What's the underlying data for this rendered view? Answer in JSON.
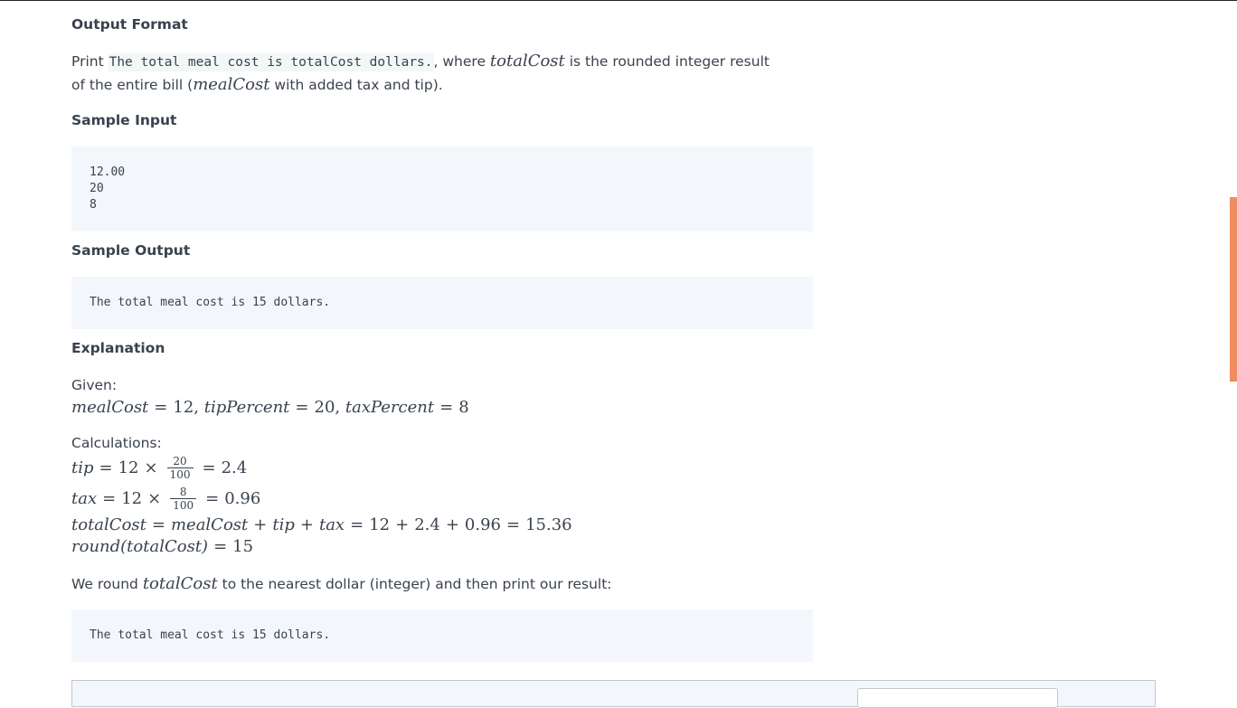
{
  "output_format": {
    "heading": "Output Format",
    "line1_prefix": "Print ",
    "line1_code": "The total meal cost is totalCost dollars.",
    "line1_mid": ", where ",
    "line1_var": "totalCost",
    "line1_suffix": " is the rounded integer result",
    "line2_prefix": "of the entire bill (",
    "line2_var": "mealCost",
    "line2_suffix": " with added tax and tip)."
  },
  "sample_input": {
    "heading": "Sample Input",
    "lines": [
      "12.00",
      "20",
      "8"
    ]
  },
  "sample_output": {
    "heading": "Sample Output",
    "text": "The total meal cost is 15 dollars."
  },
  "explanation": {
    "heading": "Explanation",
    "given_label": "Given:",
    "given": {
      "v1": "mealCost",
      "n1": "12,",
      "v2": "tipPercent",
      "n2": "20,",
      "v3": "taxPercent",
      "n3": "8"
    },
    "calc_label": "Calculations:",
    "tip": {
      "var": "tip",
      "n": "12",
      "num": "20",
      "den": "100",
      "res": "2.4"
    },
    "tax": {
      "var": "tax",
      "n": "12",
      "num": "8",
      "den": "100",
      "res": "0.96"
    },
    "total": {
      "var": "totalCost",
      "v1": "mealCost",
      "v2": "tip",
      "v3": "tax",
      "sum": "12",
      "a": "2.4",
      "b": "0.96",
      "res": "15.36"
    },
    "round": {
      "expr": "round(totalCost)",
      "res": "15"
    },
    "round_note_prefix": "We round ",
    "round_note_var": "totalCost",
    "round_note_suffix": " to the nearest dollar (integer) and then print our result:",
    "result_text": "The total meal cost is 15 dollars."
  },
  "colors": {
    "scroll_thumb": "#f08d5f",
    "code_bg": "#f3f7fc",
    "text": "#39424e"
  }
}
